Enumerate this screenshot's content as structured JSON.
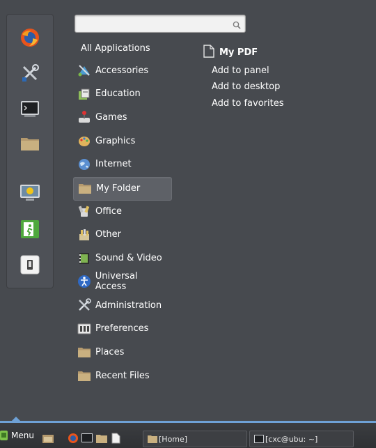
{
  "search": {
    "placeholder": "",
    "value": ""
  },
  "favorites": [
    {
      "icon": "firefox-icon"
    },
    {
      "icon": "system-tools-icon"
    },
    {
      "icon": "terminal-icon"
    },
    {
      "icon": "folder-icon"
    },
    {
      "icon": "lock-screen-icon"
    },
    {
      "icon": "logout-icon"
    },
    {
      "icon": "shutdown-icon"
    }
  ],
  "all_applications": "All Applications",
  "categories": [
    {
      "label": "Accessories",
      "icon": "accessories-icon"
    },
    {
      "label": "Education",
      "icon": "education-icon"
    },
    {
      "label": "Games",
      "icon": "games-icon"
    },
    {
      "label": "Graphics",
      "icon": "graphics-icon"
    },
    {
      "label": "Internet",
      "icon": "internet-icon"
    },
    {
      "label": "My Folder",
      "icon": "folder-icon",
      "selected": true
    },
    {
      "label": "Office",
      "icon": "office-icon"
    },
    {
      "label": "Other",
      "icon": "other-icon"
    },
    {
      "label": "Sound & Video",
      "icon": "sound-video-icon"
    },
    {
      "label": "Universal Access",
      "icon": "universal-access-icon"
    },
    {
      "label": "Administration",
      "icon": "administration-icon"
    },
    {
      "label": "Preferences",
      "icon": "preferences-icon"
    },
    {
      "label": "Places",
      "icon": "folder-icon"
    },
    {
      "label": "Recent Files",
      "icon": "folder-icon"
    }
  ],
  "app_panel": {
    "title": "My PDF",
    "actions": [
      "Add to panel",
      "Add to desktop",
      "Add to favorites"
    ]
  },
  "taskbar": {
    "menu_label": "Menu",
    "tasks": [
      {
        "label": "[Home]",
        "icon": "folder-icon"
      },
      {
        "label": "[cxc@ubu: ~]",
        "icon": "terminal-icon"
      }
    ]
  },
  "colors": {
    "accent": "#6ea1d6",
    "selected_bg": "#5e6167",
    "menu_bg": "#474a4f"
  }
}
